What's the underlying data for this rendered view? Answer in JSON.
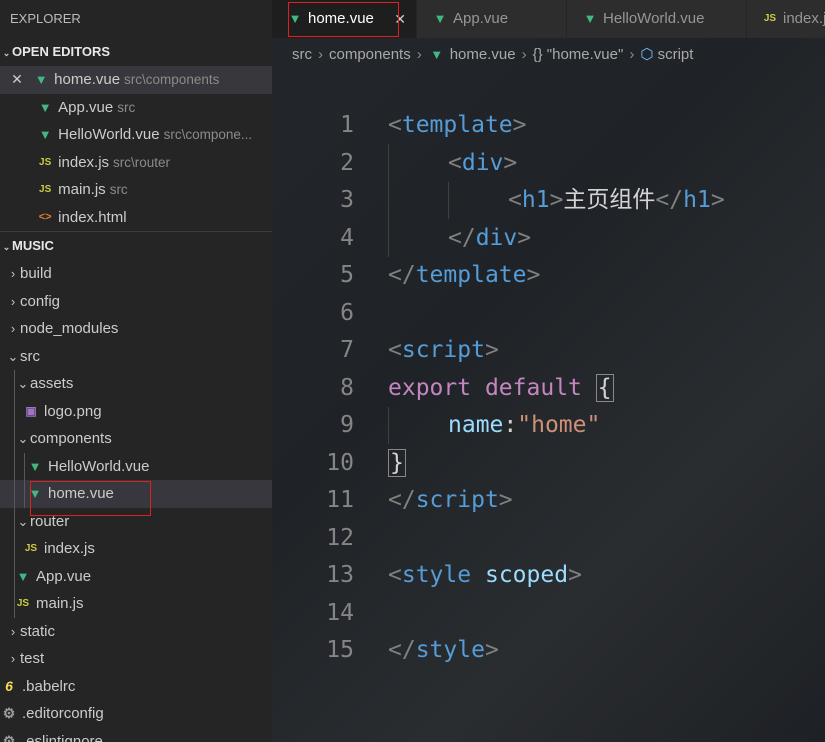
{
  "explorer": {
    "title": "EXPLORER",
    "open_editors": {
      "header": "OPEN EDITORS",
      "items": [
        {
          "name": "home.vue",
          "desc": "src\\components"
        },
        {
          "name": "App.vue",
          "desc": "src"
        },
        {
          "name": "HelloWorld.vue",
          "desc": "src\\compone..."
        },
        {
          "name": "index.js",
          "desc": "src\\router"
        },
        {
          "name": "main.js",
          "desc": "src"
        },
        {
          "name": "index.html",
          "desc": ""
        }
      ]
    },
    "project": {
      "header": "MUSIC",
      "items": [
        {
          "label": "build"
        },
        {
          "label": "config"
        },
        {
          "label": "node_modules"
        },
        {
          "label": "src"
        },
        {
          "label": "assets"
        },
        {
          "label": "logo.png"
        },
        {
          "label": "components"
        },
        {
          "label": "HelloWorld.vue"
        },
        {
          "label": "home.vue"
        },
        {
          "label": "router"
        },
        {
          "label": "index.js"
        },
        {
          "label": "App.vue"
        },
        {
          "label": "main.js"
        },
        {
          "label": "static"
        },
        {
          "label": "test"
        },
        {
          "label": ".babelrc"
        },
        {
          "label": ".editorconfig"
        },
        {
          "label": ".eslintignore"
        }
      ]
    }
  },
  "icons": {
    "vue": "▼",
    "js": "JS",
    "html": "<>",
    "image": "▣",
    "babel": "6",
    "gear": "⚙",
    "close": "✕",
    "chev_right": "›",
    "chev_down": "⌄"
  },
  "tabs": [
    {
      "label": "home.vue",
      "close": "✕"
    },
    {
      "label": "App.vue"
    },
    {
      "label": "HelloWorld.vue"
    },
    {
      "label": "index.js"
    }
  ],
  "breadcrumb": {
    "src": "src",
    "components": "components",
    "file": "home.vue",
    "braces": "{}",
    "symbol": "\"home.vue\"",
    "leaf": "script"
  },
  "code": {
    "line_numbers": [
      "1",
      "2",
      "3",
      "4",
      "5",
      "6",
      "7",
      "8",
      "9",
      "10",
      "11",
      "12",
      "13",
      "14",
      "15"
    ],
    "l1_open": "<",
    "l1_tag": "template",
    "l1_close": ">",
    "l2_open": "<",
    "l2_tag": "div",
    "l2_close": ">",
    "l3_open": "<",
    "l3_tag": "h1",
    "l3_close": ">",
    "l3_text": "主页组件",
    "l3_open2": "</",
    "l3_tag2": "h1",
    "l3_close2": ">",
    "l4_open": "</",
    "l4_tag": "div",
    "l4_close": ">",
    "l5_open": "</",
    "l5_tag": "template",
    "l5_close": ">",
    "l7_open": "<",
    "l7_tag": "script",
    "l7_close": ">",
    "l8_kw1": "export",
    "l8_kw2": "default",
    "l8_brace": "{",
    "l9_key": "name",
    "l9_colon": ":",
    "l9_val": "\"home\"",
    "l10_brace": "}",
    "l11_open": "</",
    "l11_tag": "script",
    "l11_close": ">",
    "l13_open": "<",
    "l13_tag": "style",
    "l13_attr": "scoped",
    "l13_close": ">",
    "l15_open": "</",
    "l15_tag": "style",
    "l15_close": ">"
  },
  "colors": {
    "vue_green": "#41b883",
    "js_yellow": "#cbcb41",
    "tag_blue": "#569cd6",
    "keyword_purple": "#c586c0",
    "string_orange": "#ce9178",
    "highlight_red": "#e02020"
  }
}
